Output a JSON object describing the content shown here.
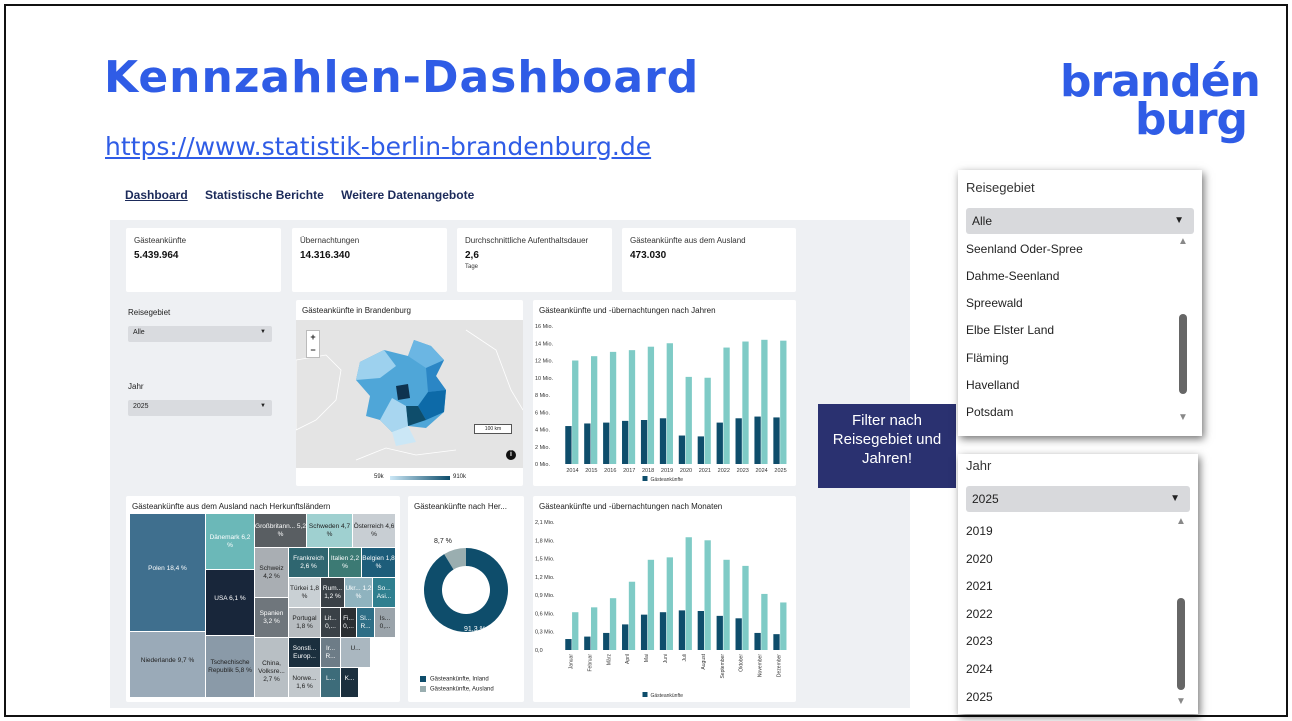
{
  "slide": {
    "title": "Kennzahlen-Dashboard",
    "url": "https://www.statistik-berlin-brandenburg.de",
    "logo_line1": "brandén",
    "logo_line2": "burg"
  },
  "nav": [
    "Dashboard",
    "Statistische Berichte",
    "Weitere Datenangebote"
  ],
  "kpis": [
    {
      "label": "Gästeankünfte",
      "value": "5.439.964",
      "sub": ""
    },
    {
      "label": "Übernachtungen",
      "value": "14.316.340",
      "sub": ""
    },
    {
      "label": "Durchschnittliche Aufenthaltsdauer",
      "value": "2,6",
      "sub": "Tage"
    },
    {
      "label": "Gästeankünfte aus dem Ausland",
      "value": "473.030",
      "sub": ""
    }
  ],
  "filters": {
    "region_label": "Reisegebiet",
    "region_value": "Alle",
    "year_label": "Jahr",
    "year_value": "2025"
  },
  "map": {
    "title": "Gästeankünfte in Brandenburg",
    "zoom_in": "+",
    "zoom_out": "−",
    "scale": "100 km",
    "legend_min": "59k",
    "legend_max": "910k",
    "info": "i"
  },
  "chart_years": {
    "title": "Gästeankünfte und -übernachtungen nach Jahren",
    "legend": "Gästeankünfte",
    "yticks": [
      "16 Mio.",
      "14 Mio.",
      "12 Mio.",
      "10 Mio.",
      "8 Mio.",
      "6 Mio.",
      "4 Mio.",
      "2 Mio.",
      "0 Mio."
    ]
  },
  "chart_months": {
    "title": "Gästeankünfte und -übernachtungen nach Monaten",
    "legend": "Gästeankünfte",
    "yticks": [
      "2,1 Mio.",
      "1,8 Mio.",
      "1,5 Mio.",
      "1,2 Mio.",
      "0,9 Mio.",
      "0,6 Mio.",
      "0,3 Mio.",
      "0,0"
    ]
  },
  "treemap": {
    "title": "Gästeankünfte aus dem Ausland nach Herkunftsländern",
    "cells": [
      {
        "label": "Polen 18,4 %",
        "color": "#3f6f8e"
      },
      {
        "label": "Niederlande 9,7 %",
        "color": "#9aaab8"
      },
      {
        "label": "Dänemark 6,2 %",
        "color": "#6bb8b8"
      },
      {
        "label": "USA 6,1 %",
        "color": "#18263a"
      },
      {
        "label": "Tschechische Republik 5,8 %",
        "color": "#8a9aa8"
      },
      {
        "label": "Großbritann... 5,2 %",
        "color": "#595e62"
      },
      {
        "label": "Schweiz 4,2 %",
        "color": "#a9aeb3"
      },
      {
        "label": "Spanien 3,2 %",
        "color": "#6f767c"
      },
      {
        "label": "China, Volksre... 2,7 %",
        "color": "#b8bfc4"
      },
      {
        "label": "Schweden 4,7 %",
        "color": "#9fd0d0"
      },
      {
        "label": "Österreich 4,6 %",
        "color": "#c8ced3"
      },
      {
        "label": "Frankreich 2,6 %",
        "color": "#2f6670"
      },
      {
        "label": "Italien 2,2 %",
        "color": "#3c7a74"
      },
      {
        "label": "Belgien 1,8 %",
        "color": "#1d5d7a"
      },
      {
        "label": "Türkei 1,8 %",
        "color": "#c9d0d4"
      },
      {
        "label": "Rum... 1,2 %",
        "color": "#3a4147"
      },
      {
        "label": "Ukr... 1,2 %",
        "color": "#8fb3bf"
      },
      {
        "label": "So... Asi...",
        "color": "#2f7f8f"
      },
      {
        "label": "Portugal 1,8 %",
        "color": "#b7bcc0"
      },
      {
        "label": "Lit... 0,...",
        "color": "#3a4147"
      },
      {
        "label": "Fi... 0,...",
        "color": "#2b2f33"
      },
      {
        "label": "Sl... R...",
        "color": "#2e6e86"
      },
      {
        "label": "Is... 0,...",
        "color": "#9aa3aa"
      },
      {
        "label": "Sonsti... Europ...",
        "color": "#1b2f3e"
      },
      {
        "label": "Ir... R...",
        "color": "#6d7c87"
      },
      {
        "label": "U...",
        "color": "#aab7c0"
      },
      {
        "label": "L...",
        "color": "#3d6c7a"
      },
      {
        "label": "Norwe... 1,6 %",
        "color": "#c2c8cc"
      },
      {
        "label": "K...",
        "color": "#1b2f3e"
      }
    ]
  },
  "donut": {
    "title": "Gästeankünfte nach Her...",
    "inland_pct": "91,3 %",
    "ausland_pct": "8,7 %",
    "legend_inland": "Gästeankünfte, Inland",
    "legend_ausland": "Gästeankünfte, Ausland"
  },
  "callout": "Filter nach Reisegebiet und Jahren!",
  "dropdown_region": {
    "label": "Reisegebiet",
    "selected": "Alle",
    "items": [
      "Seenland Oder-Spree",
      "Dahme-Seenland",
      "Spreewald",
      "Elbe Elster Land",
      "Fläming",
      "Havelland",
      "Potsdam"
    ]
  },
  "dropdown_year": {
    "label": "Jahr",
    "selected": "2025",
    "items": [
      "2019",
      "2020",
      "2021",
      "2022",
      "2023",
      "2024",
      "2025"
    ]
  },
  "chart_data": [
    {
      "type": "bar",
      "title": "Gästeankünfte und -übernachtungen nach Jahren",
      "categories": [
        "2014",
        "2015",
        "2016",
        "2017",
        "2018",
        "2019",
        "2020",
        "2021",
        "2022",
        "2023",
        "2024",
        "2025"
      ],
      "series": [
        {
          "name": "Gästeankünfte",
          "values": [
            4.4,
            4.7,
            4.8,
            5.0,
            5.1,
            5.3,
            3.3,
            3.2,
            4.8,
            5.3,
            5.5,
            5.4
          ],
          "color": "#0e4d6b"
        },
        {
          "values": [
            12.0,
            12.5,
            13.0,
            13.2,
            13.6,
            14.0,
            10.1,
            10.0,
            13.5,
            14.2,
            14.4,
            14.3
          ],
          "color": "#7fcbc6"
        }
      ],
      "ylim": [
        0,
        16
      ]
    },
    {
      "type": "bar",
      "title": "Gästeankünfte und -übernachtungen nach Monaten",
      "categories": [
        "Januar",
        "Februar",
        "März",
        "April",
        "Mai",
        "Juni",
        "Juli",
        "August",
        "September",
        "Oktober",
        "November",
        "Dezember"
      ],
      "series": [
        {
          "name": "Gästeankünfte",
          "values": [
            0.18,
            0.22,
            0.28,
            0.42,
            0.58,
            0.62,
            0.65,
            0.64,
            0.56,
            0.52,
            0.28,
            0.26
          ],
          "color": "#0e4d6b"
        },
        {
          "values": [
            0.62,
            0.7,
            0.85,
            1.12,
            1.48,
            1.52,
            1.85,
            1.8,
            1.48,
            1.38,
            0.92,
            0.78
          ],
          "color": "#7fcbc6"
        }
      ],
      "ylim": [
        0,
        2.1
      ]
    },
    {
      "type": "pie",
      "title": "Gästeankünfte nach Her...",
      "categories": [
        "Gästeankünfte, Inland",
        "Gästeankünfte, Ausland"
      ],
      "values": [
        91.3,
        8.7
      ],
      "colors": [
        "#0e4d6b",
        "#9aaeb0"
      ]
    }
  ]
}
